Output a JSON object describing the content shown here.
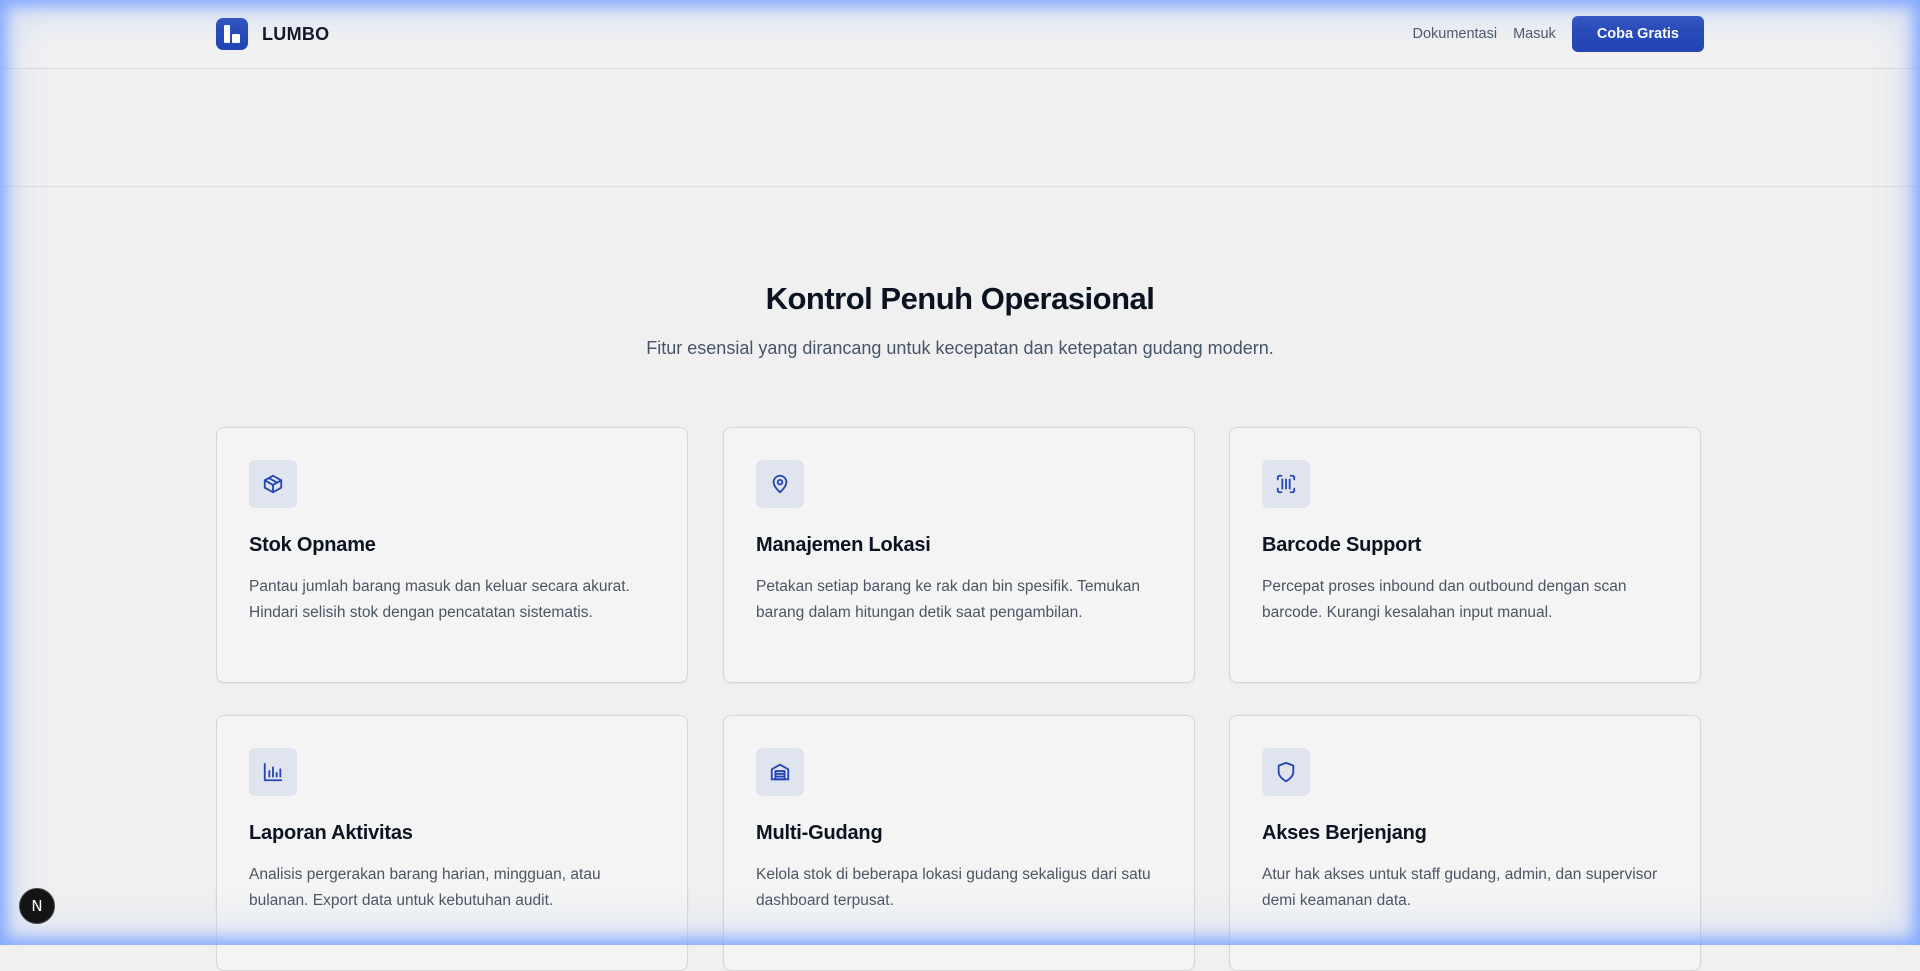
{
  "nav": {
    "brand": "LUMBO",
    "links": [
      "Dokumentasi",
      "Masuk"
    ],
    "cta": "Coba Gratis"
  },
  "features": {
    "title": "Kontrol Penuh Operasional",
    "subtitle": "Fitur esensial yang dirancang untuk kecepatan dan ketepatan gudang modern.",
    "cards": [
      {
        "icon": "box-icon",
        "title": "Stok Opname",
        "desc": "Pantau jumlah barang masuk dan keluar secara akurat. Hindari selisih stok dengan pencatatan sistematis."
      },
      {
        "icon": "map-pin-icon",
        "title": "Manajemen Lokasi",
        "desc": "Petakan setiap barang ke rak dan bin spesifik. Temukan barang dalam hitungan detik saat pengambilan."
      },
      {
        "icon": "barcode-scan-icon",
        "title": "Barcode Support",
        "desc": "Percepat proses inbound dan outbound dengan scan barcode. Kurangi kesalahan input manual."
      },
      {
        "icon": "bar-chart-icon",
        "title": "Laporan Aktivitas",
        "desc": "Analisis pergerakan barang harian, mingguan, atau bulanan. Export data untuk kebutuhan audit."
      },
      {
        "icon": "warehouse-icon",
        "title": "Multi-Gudang",
        "desc": "Kelola stok di beberapa lokasi gudang sekaligus dari satu dashboard terpusat."
      },
      {
        "icon": "shield-icon",
        "title": "Akses Berjenjang",
        "desc": "Atur hak akses untuk staff gudang, admin, dan supervisor demi keamanan data."
      }
    ]
  },
  "badge": {
    "label": "N"
  },
  "colors": {
    "accent": "#2345b5",
    "icon_bg": "#e0e4ee",
    "background": "#f0f0f0"
  }
}
